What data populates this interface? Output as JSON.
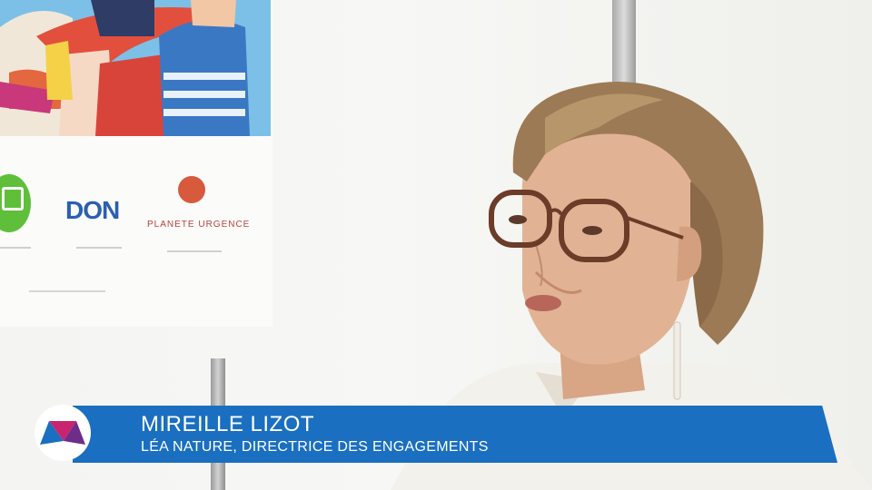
{
  "lower_third": {
    "name": "MIREILLE LIZOT",
    "title": "LÉA NATURE, DIRECTRICE DES ENGAGEMENTS",
    "bar_color": "#1a6fc0"
  },
  "poster": {
    "logo_don": "DON",
    "logo_planete": "PLANETE URGENCE"
  },
  "icons": {
    "channel_logo": "m-logo-icon"
  }
}
